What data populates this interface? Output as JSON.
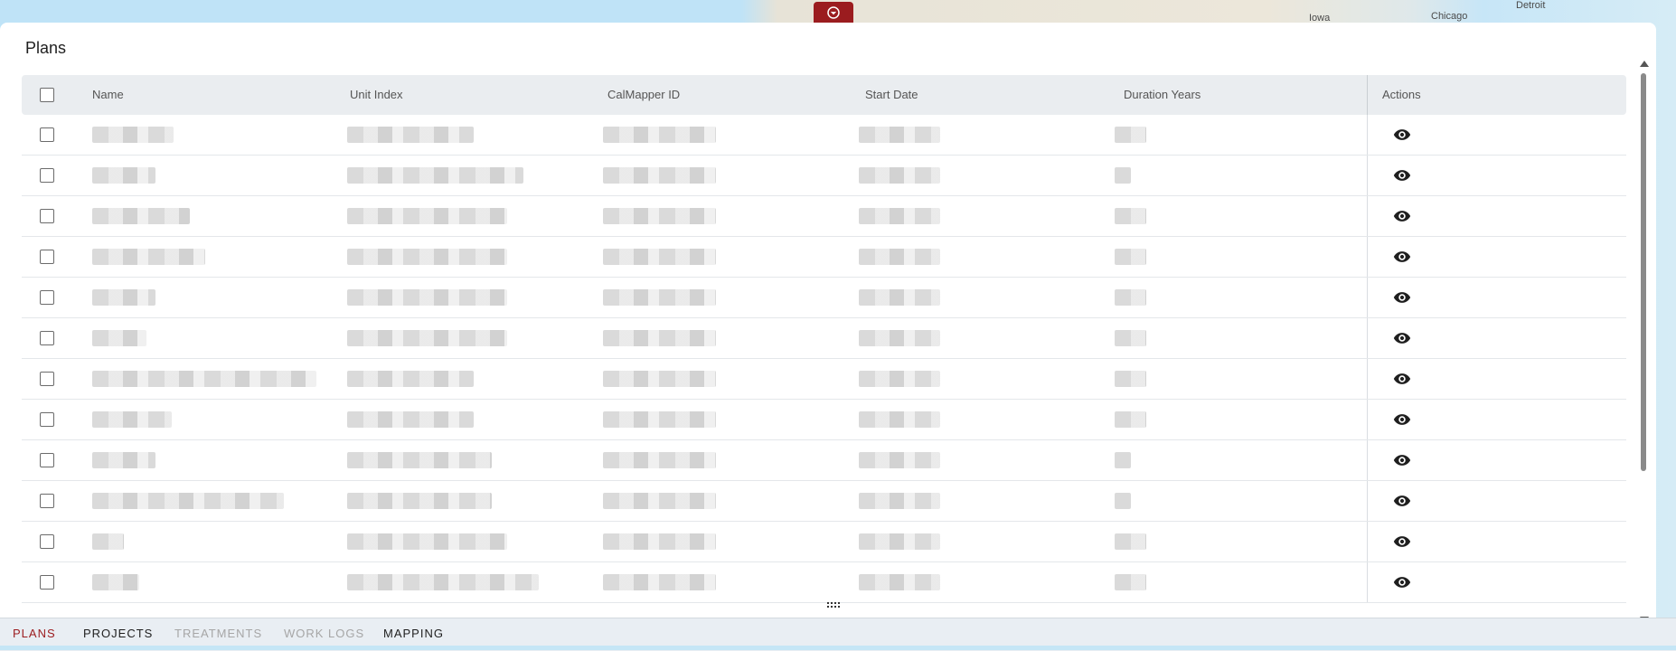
{
  "map": {
    "labels": [
      "Iowa",
      "Chicago",
      "Detroit"
    ],
    "accent": "#9b1c1f"
  },
  "panel": {
    "title": "Plans"
  },
  "table": {
    "columns": [
      "Name",
      "Unit Index",
      "CalMapper ID",
      "Start Date",
      "Duration Years",
      "Actions"
    ],
    "row_count": 12,
    "row_action_icon": "eye-icon"
  },
  "tabs": [
    {
      "label": "PLANS",
      "state": "active"
    },
    {
      "label": "PROJECTS",
      "state": "enabled"
    },
    {
      "label": "TREATMENTS",
      "state": "disabled"
    },
    {
      "label": "WORK LOGS",
      "state": "disabled"
    },
    {
      "label": "MAPPING",
      "state": "enabled"
    }
  ]
}
